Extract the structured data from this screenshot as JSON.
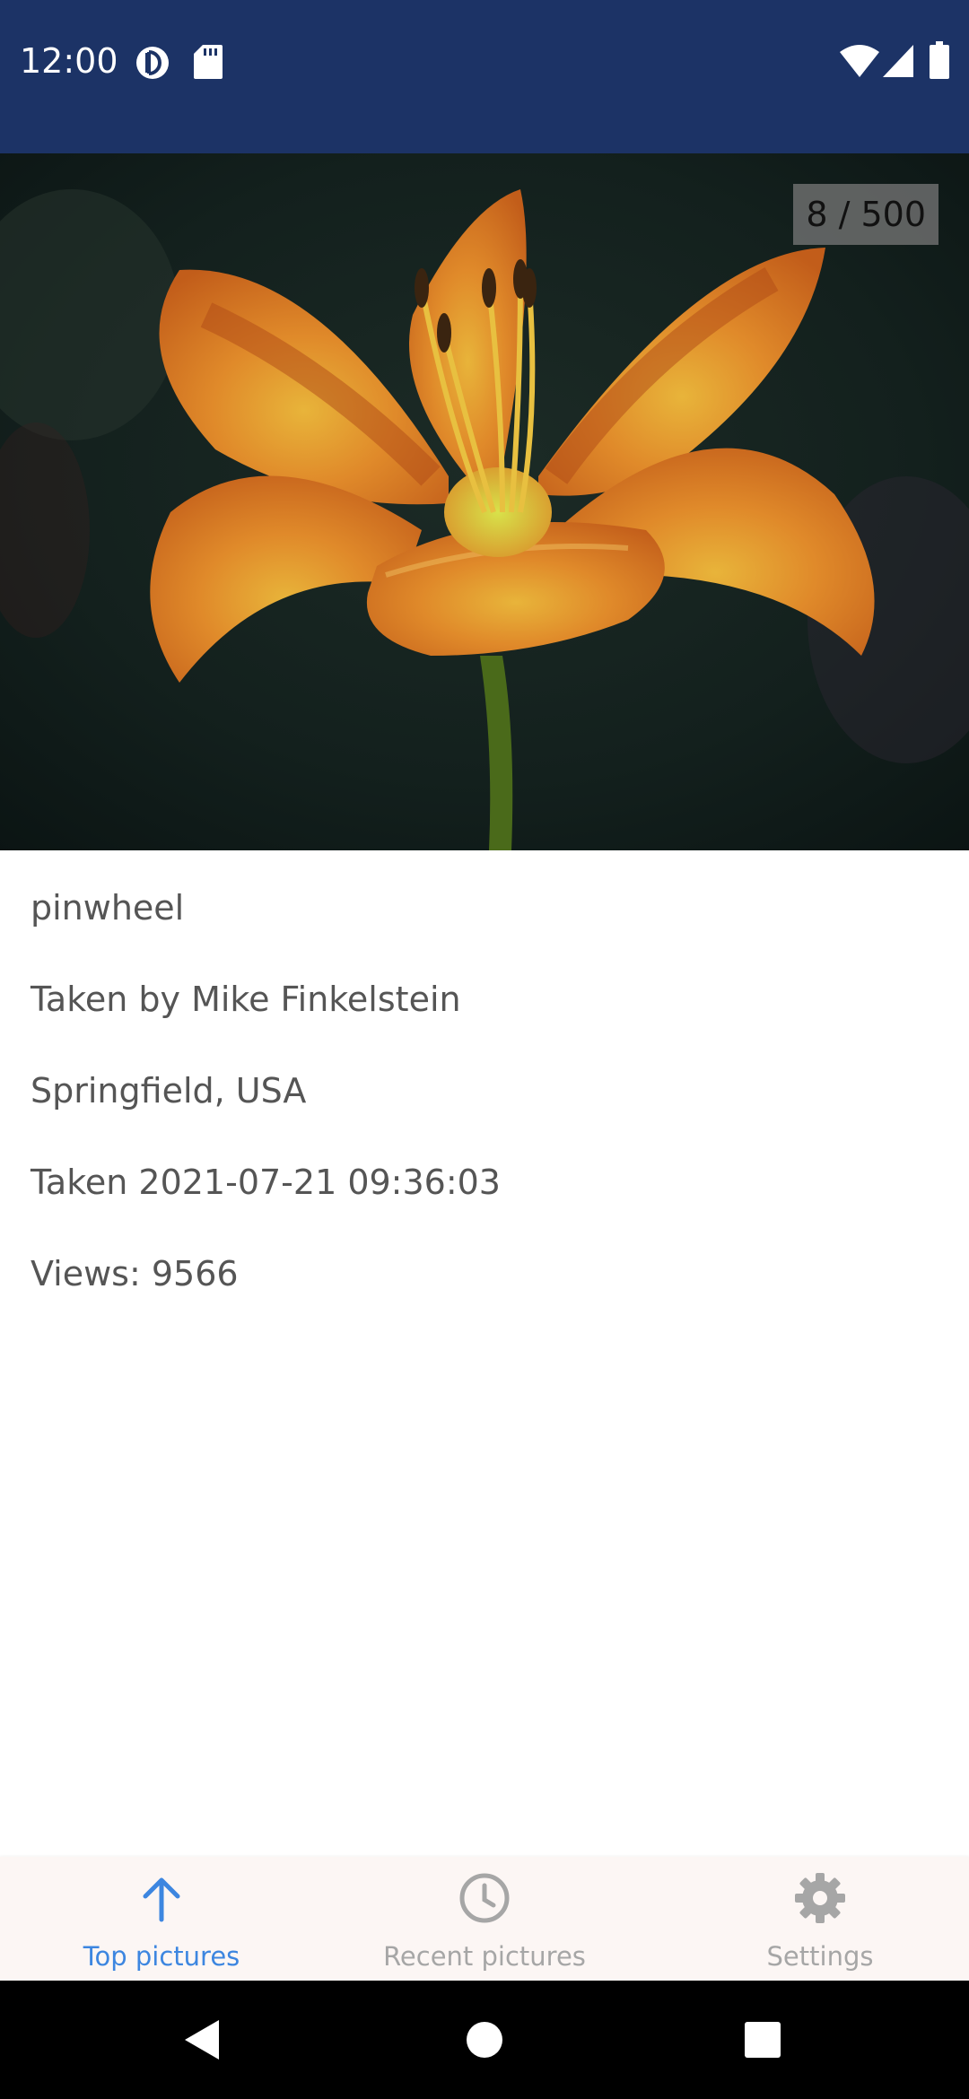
{
  "status_bar": {
    "time": "12:00",
    "background": "#1c3366",
    "left_icons": [
      "cast-icon",
      "sd-card-icon"
    ],
    "right_icons": [
      "wifi-icon",
      "signal-icon",
      "battery-icon"
    ]
  },
  "photo": {
    "subject": "orange lily",
    "counter": "8 / 500"
  },
  "details": {
    "title": "pinwheel",
    "author": "Taken by Mike Finkelstein",
    "location": "Springfield, USA",
    "taken": "Taken 2021-07-21 09:36:03",
    "views": "Views: 9566"
  },
  "bottom_nav": {
    "active_color": "#3d86e0",
    "inactive_color": "#a6a6a6",
    "items": [
      {
        "label": "Top pictures",
        "icon": "arrow-up-icon",
        "active": true
      },
      {
        "label": "Recent pictures",
        "icon": "clock-icon",
        "active": false
      },
      {
        "label": "Settings",
        "icon": "gear-icon",
        "active": false
      }
    ]
  },
  "system_nav": {
    "buttons": [
      "back-icon",
      "home-icon",
      "recents-icon"
    ]
  }
}
